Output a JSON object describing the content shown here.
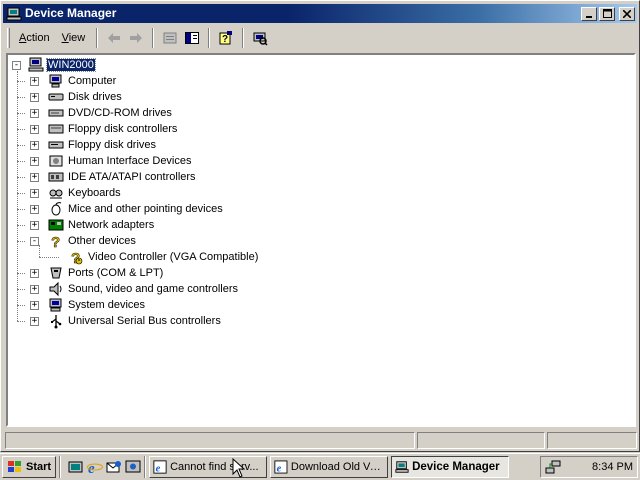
{
  "window": {
    "title": "Device Manager",
    "controls": {
      "minimize": "0",
      "maximize": "1",
      "close": "r"
    }
  },
  "menu": [
    {
      "label": "Action",
      "accel": "A",
      "rest": "ction"
    },
    {
      "label": "View",
      "accel": "V",
      "rest": "iew"
    }
  ],
  "toolbar": {
    "buttons": [
      "back-icon",
      "forward-icon",
      "properties-icon",
      "console-tree-icon",
      "help-icon",
      "scan-hardware-icon"
    ]
  },
  "tree": {
    "root": "WIN2000",
    "categories": [
      {
        "label": "Computer",
        "icon": "computer-icon",
        "expanded": false
      },
      {
        "label": "Disk drives",
        "icon": "disk-drive-icon",
        "expanded": false
      },
      {
        "label": "DVD/CD-ROM drives",
        "icon": "cdrom-icon",
        "expanded": false
      },
      {
        "label": "Floppy disk controllers",
        "icon": "floppy-controller-icon",
        "expanded": false
      },
      {
        "label": "Floppy disk drives",
        "icon": "floppy-drive-icon",
        "expanded": false
      },
      {
        "label": "Human Interface Devices",
        "icon": "hid-icon",
        "expanded": false
      },
      {
        "label": "IDE ATA/ATAPI controllers",
        "icon": "ide-controller-icon",
        "expanded": false
      },
      {
        "label": "Keyboards",
        "icon": "keyboard-icon",
        "expanded": false
      },
      {
        "label": "Mice and other pointing devices",
        "icon": "mouse-icon",
        "expanded": false
      },
      {
        "label": "Network adapters",
        "icon": "network-adapter-icon",
        "expanded": false
      },
      {
        "label": "Other devices",
        "icon": "unknown-device-icon",
        "expanded": true,
        "children": [
          {
            "label": "Video Controller (VGA Compatible)",
            "icon": "warning-device-icon"
          }
        ]
      },
      {
        "label": "Ports (COM & LPT)",
        "icon": "port-icon",
        "expanded": false
      },
      {
        "label": "Sound, video and game controllers",
        "icon": "sound-icon",
        "expanded": false
      },
      {
        "label": "System devices",
        "icon": "system-device-icon",
        "expanded": false
      },
      {
        "label": "Universal Serial Bus controllers",
        "icon": "usb-icon",
        "expanded": false
      }
    ]
  },
  "taskbar": {
    "start_label": "Start",
    "quick_launch": [
      "show-desktop-icon",
      "internet-explorer-icon",
      "outlook-express-icon",
      "media-icon"
    ],
    "tasks": [
      {
        "label": "Cannot find serv...",
        "active": false
      },
      {
        "label": "Download Old Ve...",
        "active": false
      },
      {
        "label": "Device Manager",
        "active": true
      }
    ],
    "clock": "8:34 PM"
  },
  "colors": {
    "titlebar_start": "#0a246a",
    "titlebar_end": "#a6caf0",
    "face": "#d4d0c8",
    "selection": "#0a246a"
  }
}
